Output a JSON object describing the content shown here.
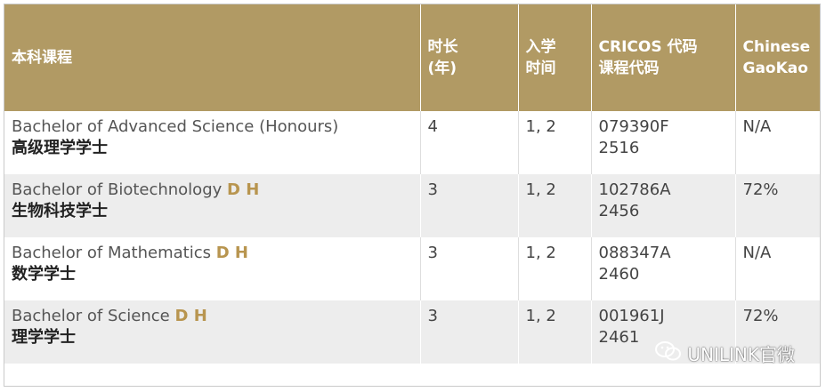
{
  "header": {
    "col1": "本科课程",
    "col2_line1": "时长",
    "col2_line2": "(年)",
    "col3_line1": "入学",
    "col3_line2": "时间",
    "col4_line1": "CRICOS 代码",
    "col4_line2": "课程代码",
    "col5_line1": "Chinese",
    "col5_line2": "GaoKao"
  },
  "rows": [
    {
      "name_en": "Bachelor of Advanced Science (Honours)",
      "tags": "",
      "name_cn": "高级理学学士",
      "duration": "4",
      "intake": "1, 2",
      "cricos": "079390F",
      "course_code": "2516",
      "gaokao": "N/A"
    },
    {
      "name_en": "Bachelor of Biotechnology",
      "tags": "D H",
      "name_cn": "生物科技学士",
      "duration": "3",
      "intake": "1, 2",
      "cricos": "102786A",
      "course_code": "2456",
      "gaokao": "72%"
    },
    {
      "name_en": "Bachelor of Mathematics",
      "tags": "D H",
      "name_cn": "数学学士",
      "duration": "3",
      "intake": "1, 2",
      "cricos": "088347A",
      "course_code": "2460",
      "gaokao": "N/A"
    },
    {
      "name_en": "Bachelor of Science",
      "tags": "D H",
      "name_cn": "理学学士",
      "duration": "3",
      "intake": "1, 2",
      "cricos": "001961J",
      "course_code": "2461",
      "gaokao": "72%"
    }
  ],
  "watermark": {
    "icon": "wechat-icon",
    "text": "UNILINK官微"
  },
  "colors": {
    "header_bg": "#b19a64",
    "tag": "#b8954f",
    "stripe": "#ededed"
  }
}
